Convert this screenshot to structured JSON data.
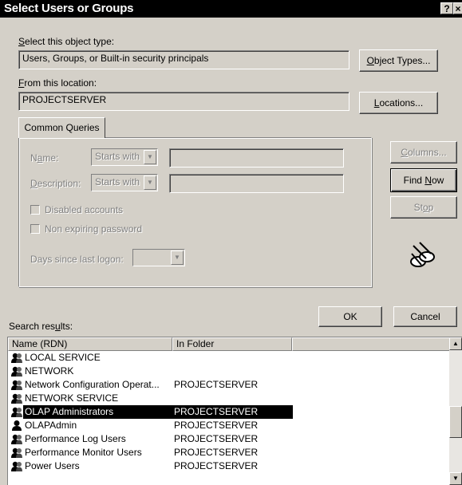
{
  "window": {
    "title": "Select Users or Groups",
    "help_btn": "?",
    "close_btn": "×"
  },
  "object_type": {
    "label": "Select this object type:",
    "value": "Users, Groups, or Built-in security principals",
    "button": "Object Types..."
  },
  "location": {
    "label": "From this location:",
    "value": "PROJECTSERVER",
    "button": "Locations..."
  },
  "queries": {
    "tab": "Common Queries",
    "name_label": "Name:",
    "name_mode": "Starts with",
    "name_value": "",
    "description_label": "Description:",
    "description_mode": "Starts with",
    "description_value": "",
    "disabled_accounts": "Disabled accounts",
    "non_expiring_password": "Non expiring password",
    "days_since_logon_label": "Days since last logon:",
    "days_since_logon_value": ""
  },
  "buttons": {
    "columns": "Columns...",
    "find_now": "Find Now",
    "stop": "Stop",
    "ok": "OK",
    "cancel": "Cancel"
  },
  "results": {
    "label": "Search results:",
    "columns": [
      "Name (RDN)",
      "In Folder"
    ],
    "rows": [
      {
        "name": "LOCAL SERVICE",
        "folder": "",
        "icon": "group-icon"
      },
      {
        "name": "NETWORK",
        "folder": "",
        "icon": "group-icon"
      },
      {
        "name": "Network Configuration Operat...",
        "folder": "PROJECTSERVER",
        "icon": "group-icon"
      },
      {
        "name": "NETWORK SERVICE",
        "folder": "",
        "icon": "group-icon"
      },
      {
        "name": "OLAP Administrators",
        "folder": "PROJECTSERVER",
        "icon": "group-icon",
        "selected": true
      },
      {
        "name": "OLAPAdmin",
        "folder": "PROJECTSERVER",
        "icon": "user-icon"
      },
      {
        "name": "Performance Log Users",
        "folder": "PROJECTSERVER",
        "icon": "group-icon"
      },
      {
        "name": "Performance Monitor Users",
        "folder": "PROJECTSERVER",
        "icon": "group-icon"
      },
      {
        "name": "Power Users",
        "folder": "PROJECTSERVER",
        "icon": "group-icon"
      }
    ]
  }
}
